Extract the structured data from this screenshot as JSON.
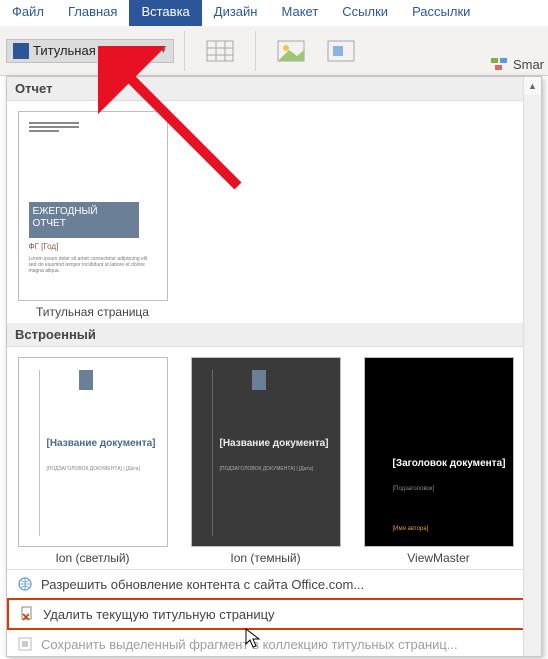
{
  "tabs": {
    "file": "Файл",
    "home": "Главная",
    "insert": "Вставка",
    "design": "Дизайн",
    "layout": "Макет",
    "references": "Ссылки",
    "mailings": "Рассылки"
  },
  "ribbon": {
    "title_page": "Титульная страница",
    "smart": "Smar"
  },
  "section1": {
    "header": "Отчет"
  },
  "thumb1": {
    "title_line1": "ЕЖЕГОДНЫЙ",
    "title_line2": "ОТЧЕТ",
    "sub": "ФГ [Год]",
    "label": "Титульная страница"
  },
  "section2": {
    "header": "Встроенный"
  },
  "thumb2": {
    "title": "[Название документа]",
    "label": "Ion (светлый)"
  },
  "thumb3": {
    "title": "[Название документа]",
    "label": "Ion (темный)"
  },
  "thumb4": {
    "title": "[Заголовок документа]",
    "foot": "[Имя автора]",
    "label": "ViewMaster"
  },
  "footer": {
    "update": "Разрешить обновление контента с сайта Office.com...",
    "remove": "Удалить текущую титульную страницу",
    "save": "Сохранить выделенный фрагмент в коллекцию титульных страниц..."
  }
}
